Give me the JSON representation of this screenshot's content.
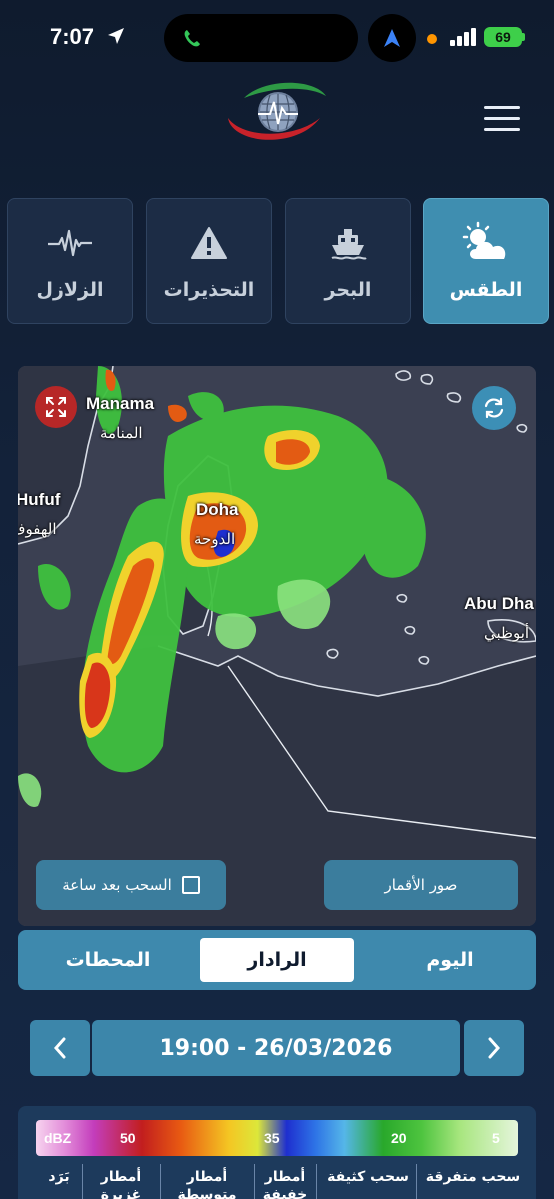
{
  "status_bar": {
    "time": "7:07",
    "battery": "69"
  },
  "categories": [
    {
      "key": "weather",
      "label": "الطقس",
      "icon": "partly-cloudy-icon",
      "active": true
    },
    {
      "key": "sea",
      "label": "البحر",
      "icon": "ship-icon",
      "active": false
    },
    {
      "key": "warnings",
      "label": "التحذيرات",
      "icon": "warning-icon",
      "active": false
    },
    {
      "key": "earthquakes",
      "label": "الزلازل",
      "icon": "seismograph-icon",
      "active": false
    }
  ],
  "map": {
    "cities": [
      {
        "en": "Manama",
        "ar": "المنامة"
      },
      {
        "en": "Hufuf",
        "ar": "الهفوف"
      },
      {
        "en": "Doha",
        "ar": "الدوحة"
      },
      {
        "en": "Abu Dha",
        "ar": "أبوظبي"
      }
    ],
    "satellite_button": "صور الأقمار",
    "clouds_hour_label": "السحب بعد ساعة"
  },
  "tabs": {
    "today": "اليوم",
    "radar": "الرادار",
    "stations": "المحطات",
    "active": "radar"
  },
  "date_nav": {
    "value": "19:00 - 26/03/2026"
  },
  "legend": {
    "unit": "dBZ",
    "ticks": [
      "50",
      "35",
      "20",
      "5"
    ],
    "categories": [
      "بَرَد",
      "أمطار غزيرة",
      "أمطار متوسطة",
      "أمطار خفيفة",
      "سحب كثيفة",
      "سحب متفرقة"
    ]
  },
  "colors": {
    "accent": "#3f8eb0",
    "background": "#13223a",
    "close_red": "#b72727"
  }
}
